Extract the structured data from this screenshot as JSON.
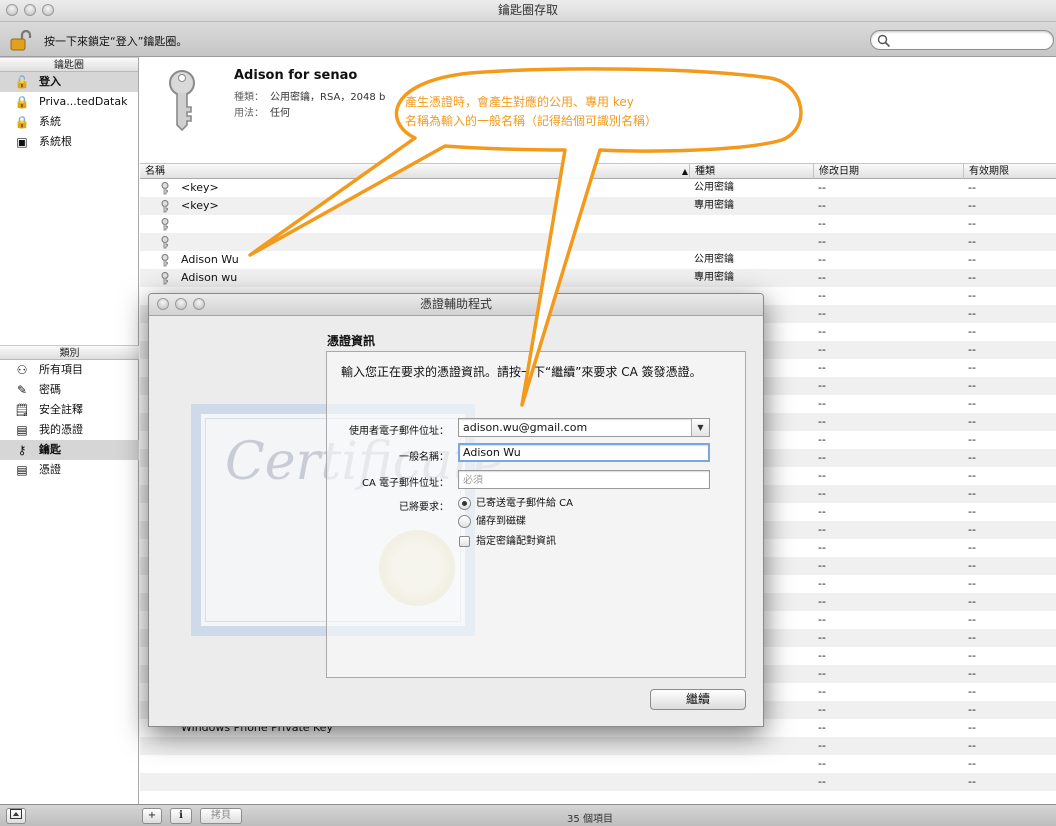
{
  "window": {
    "title": "鑰匙圈存取",
    "lock_hint": "按一下來鎖定“登入”鑰匙圈。",
    "search_placeholder": ""
  },
  "sidebar": {
    "keychains_header": "鑰匙圈",
    "keychains": [
      {
        "label": "登入",
        "icon": "open-lock-icon",
        "selected": true
      },
      {
        "label": "Priva...tedDatak",
        "icon": "lock-icon",
        "selected": false
      },
      {
        "label": "系統",
        "icon": "lock-icon",
        "selected": false
      },
      {
        "label": "系統根",
        "icon": "folder-icon",
        "selected": false
      }
    ],
    "category_header": "類別",
    "categories": [
      {
        "label": "所有項目",
        "icon": "people-icon",
        "selected": false
      },
      {
        "label": "密碼",
        "icon": "pencil-icon",
        "selected": false
      },
      {
        "label": "安全註釋",
        "icon": "note-icon",
        "selected": false
      },
      {
        "label": "我的憑證",
        "icon": "certificate-icon",
        "selected": false
      },
      {
        "label": "鑰匙",
        "icon": "key-icon",
        "selected": true
      },
      {
        "label": "憑證",
        "icon": "certificate-icon",
        "selected": false
      }
    ]
  },
  "detail": {
    "name": "Adison for senao",
    "kind_label": "種類：",
    "kind_value": "公用密鑰，RSA，2048 b",
    "usage_label": "用法：",
    "usage_value": "任何"
  },
  "table": {
    "columns": {
      "name": "名稱",
      "kind": "種類",
      "modified": "修改日期",
      "expires": "有效期限"
    },
    "rows": [
      {
        "name": "<key>",
        "kind": "公用密鑰",
        "modified": "--",
        "expires": "--"
      },
      {
        "name": "<key>",
        "kind": "專用密鑰",
        "modified": "--",
        "expires": "--"
      },
      {
        "name": "",
        "kind": "",
        "modified": "--",
        "expires": "--",
        "blurred": true
      },
      {
        "name": "",
        "kind": "",
        "modified": "--",
        "expires": "--",
        "blurred": true
      },
      {
        "name": "Adison Wu",
        "kind": "公用密鑰",
        "modified": "--",
        "expires": "--"
      },
      {
        "name": "Adison wu",
        "kind": "專用密鑰",
        "modified": "--",
        "expires": "--"
      }
    ],
    "lower_row_name": "Windows Phone Private Key",
    "filler_dash": "--"
  },
  "bottombar": {
    "add_label": "+",
    "info_label": "i",
    "copy_label": "拷貝",
    "count": "35 個項目"
  },
  "dialog": {
    "title": "憑證輔助程式",
    "heading": "憑證資訊",
    "intro": "輸入您正在要求的憑證資訊。請按一下“繼續”來要求 CA 簽發憑證。",
    "email_label": "使用者電子郵件位址：",
    "email_value": "adison.wu@gmail.com",
    "common_name_label": "一般名稱：",
    "common_name_value": "Adison Wu",
    "ca_email_label": "CA 電子郵件位址：",
    "ca_email_placeholder": "必須",
    "request_label": "已將要求：",
    "option_email_ca": "已寄送電子郵件給 CA",
    "option_save_disk": "儲存到磁碟",
    "option_key_pair": "指定密鑰配對資訊",
    "continue_label": "繼續",
    "art_text": "Certificate"
  },
  "callout": {
    "line1": "產生憑證時，會產生對應的公用、專用 key",
    "line2": "名稱為輸入的一般名稱（記得給個可識別名稱）",
    "color": "#f39a1c"
  }
}
